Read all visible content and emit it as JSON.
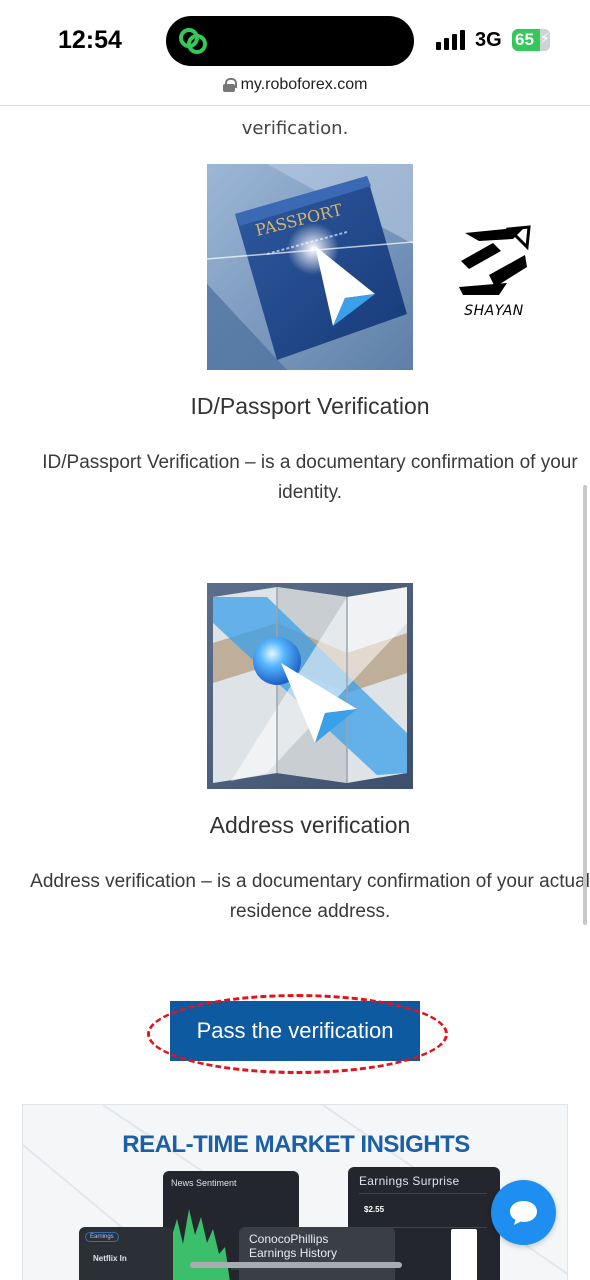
{
  "status_bar": {
    "time": "12:54",
    "network": "3G",
    "battery": "65",
    "island_icon": "link-app-icon",
    "signal_icon": "cellular-signal-icon"
  },
  "browser": {
    "url": "my.roboforex.com",
    "lock_icon": "lock-icon"
  },
  "page": {
    "prev_text_tail": "verification.",
    "sections": [
      {
        "image_icon": "passport-image",
        "image_label": "PASSPORT",
        "title": "ID/Passport Verification",
        "description": "ID/Passport Verification – is a documentary confirmation of your identity."
      },
      {
        "image_icon": "map-image",
        "title": "Address verification",
        "description": "Address verification – is a documentary confirmation of your actual residence address."
      }
    ],
    "watermark_text": "SHAYAN",
    "cta_label": "Pass the verification",
    "cta_highlight_color": "#e0141d",
    "accent_color": "#0e5aa0"
  },
  "banner": {
    "title": "REAL-TIME MARKET INSIGHTS",
    "news_card_title": "News Sentiment",
    "earnings_card_title": "Earnings Surprise",
    "earnings_value": "$2.55",
    "conoco_title_line1": "ConocoPhillips",
    "conoco_title_line2": "Earnings History",
    "small_card_pill": "Earnings",
    "small_card_title": "Netflix In"
  },
  "chat": {
    "icon": "chat-bubble-icon"
  }
}
